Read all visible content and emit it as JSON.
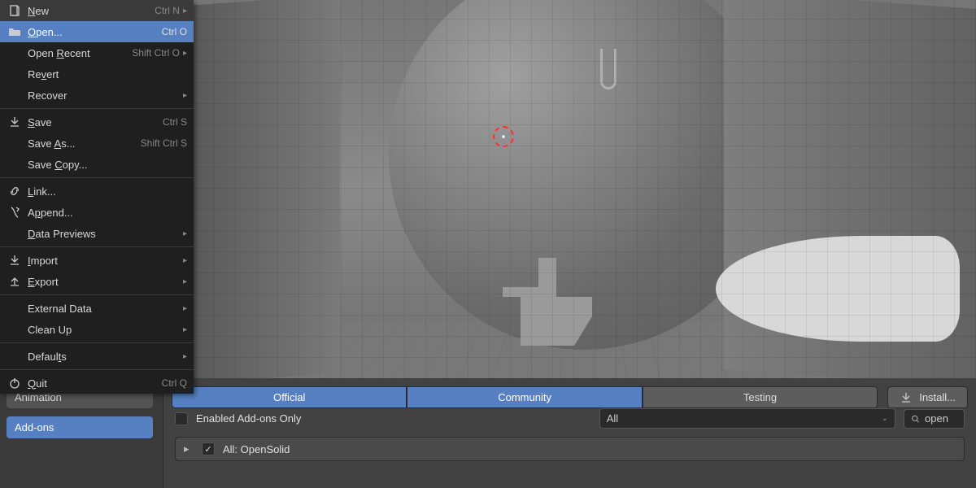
{
  "file_menu": {
    "groups": [
      [
        {
          "icon": "document-new-icon",
          "label_pre": "",
          "ul": "N",
          "label_post": "ew",
          "shortcut": "Ctrl N",
          "submenu": true
        },
        {
          "icon": "folder-open-icon",
          "label_pre": "",
          "ul": "O",
          "label_post": "pen...",
          "shortcut": "Ctrl O",
          "highlighted": true
        },
        {
          "icon": "",
          "label_pre": "Open ",
          "ul": "R",
          "label_post": "ecent",
          "shortcut": "Shift Ctrl O",
          "submenu": true
        },
        {
          "icon": "",
          "label_pre": "Re",
          "ul": "v",
          "label_post": "ert",
          "shortcut": ""
        },
        {
          "icon": "",
          "label_pre": "Recover",
          "ul": "",
          "label_post": "",
          "shortcut": "",
          "submenu": true
        }
      ],
      [
        {
          "icon": "save-icon",
          "label_pre": "",
          "ul": "S",
          "label_post": "ave",
          "shortcut": "Ctrl S"
        },
        {
          "icon": "",
          "label_pre": "Save ",
          "ul": "A",
          "label_post": "s...",
          "shortcut": "Shift Ctrl S"
        },
        {
          "icon": "",
          "label_pre": "Save ",
          "ul": "C",
          "label_post": "opy...",
          "shortcut": ""
        }
      ],
      [
        {
          "icon": "link-icon",
          "label_pre": "",
          "ul": "L",
          "label_post": "ink...",
          "shortcut": ""
        },
        {
          "icon": "append-icon",
          "label_pre": "A",
          "ul": "p",
          "label_post": "pend...",
          "shortcut": ""
        },
        {
          "icon": "",
          "label_pre": "",
          "ul": "D",
          "label_post": "ata Previews",
          "shortcut": "",
          "submenu": true
        }
      ],
      [
        {
          "icon": "import-icon",
          "label_pre": "",
          "ul": "I",
          "label_post": "mport",
          "shortcut": "",
          "submenu": true
        },
        {
          "icon": "export-icon",
          "label_pre": "",
          "ul": "E",
          "label_post": "xport",
          "shortcut": "",
          "submenu": true
        }
      ],
      [
        {
          "icon": "",
          "label_pre": "External Data",
          "ul": "",
          "label_post": "",
          "shortcut": "",
          "submenu": true
        },
        {
          "icon": "",
          "label_pre": "Clean Up",
          "ul": "",
          "label_post": "",
          "shortcut": "",
          "submenu": true
        }
      ],
      [
        {
          "icon": "",
          "label_pre": "Defaul",
          "ul": "t",
          "label_post": "s",
          "shortcut": "",
          "submenu": true
        }
      ],
      [
        {
          "icon": "power-icon",
          "label_pre": "",
          "ul": "Q",
          "label_post": "uit",
          "shortcut": "Ctrl Q"
        }
      ]
    ]
  },
  "sidebar": {
    "items": [
      {
        "label": "Animation",
        "active": false
      },
      {
        "label": "Add-ons",
        "active": true
      }
    ]
  },
  "tabs": [
    {
      "label": "Official",
      "active": true
    },
    {
      "label": "Community",
      "active": true
    },
    {
      "label": "Testing",
      "active": false
    }
  ],
  "install_label": "Install...",
  "filter": {
    "enabled_only_label": "Enabled Add-ons Only",
    "category": "All",
    "search_value": "open"
  },
  "addon": {
    "checked": true,
    "label": "All: OpenSolid"
  }
}
